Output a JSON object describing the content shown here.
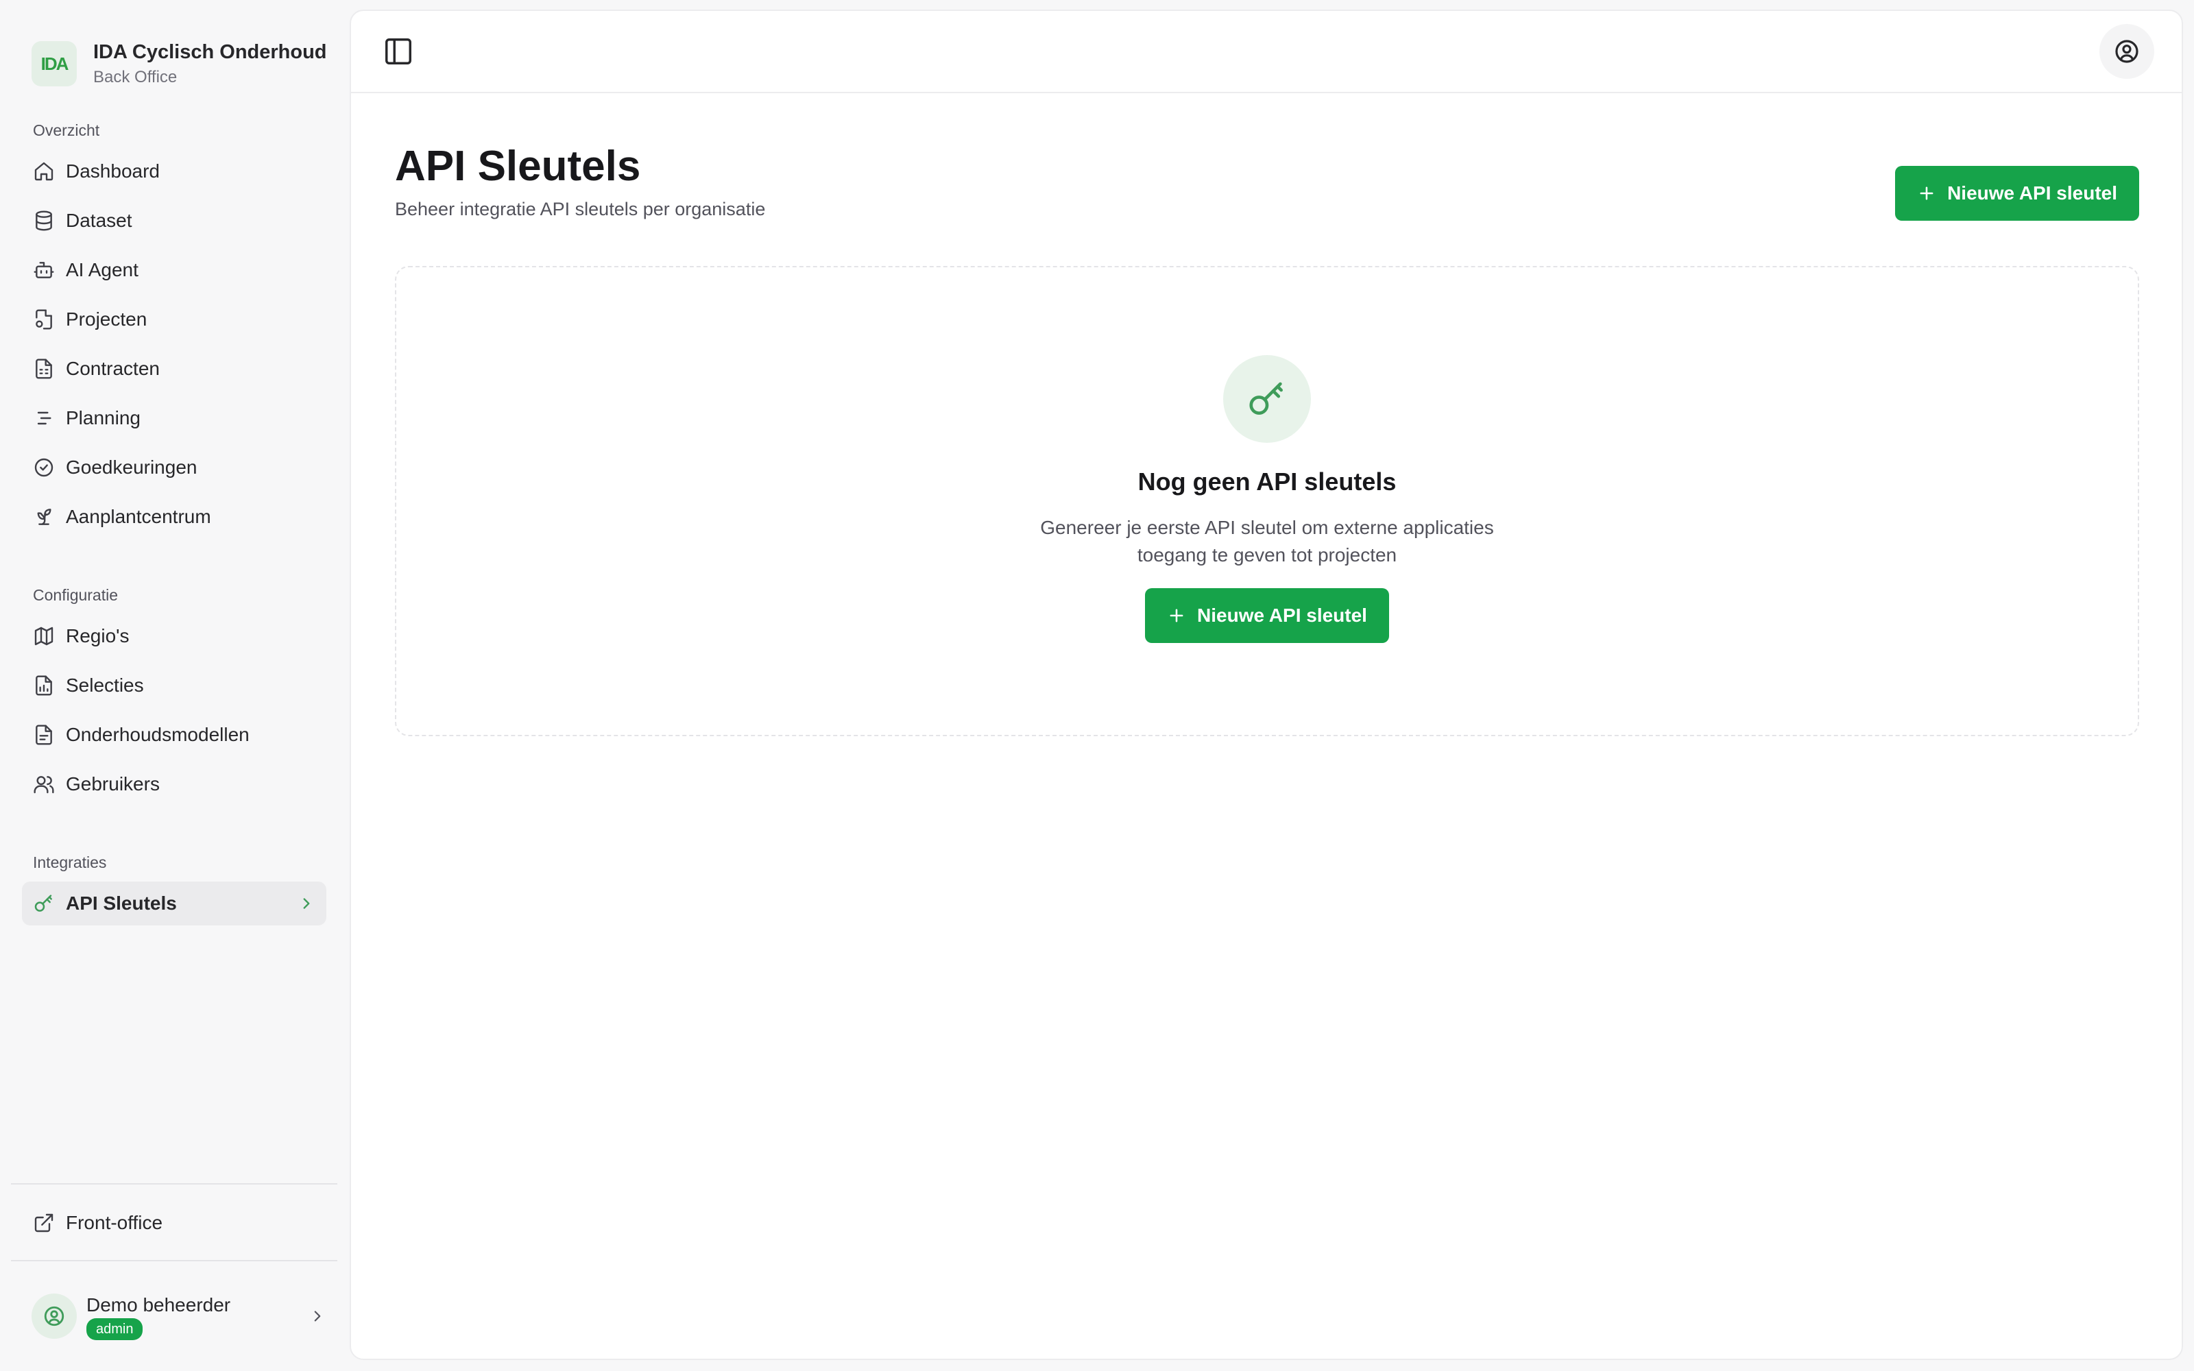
{
  "brand": {
    "logo_text": "IDA",
    "title": "IDA Cyclisch Onderhoud",
    "subtitle": "Back Office"
  },
  "sidebar": {
    "groups": [
      {
        "label": "Overzicht",
        "items": [
          {
            "label": "Dashboard",
            "icon": "home-icon"
          },
          {
            "label": "Dataset",
            "icon": "database-icon"
          },
          {
            "label": "AI Agent",
            "icon": "bot-icon"
          },
          {
            "label": "Projecten",
            "icon": "file-cog-icon"
          },
          {
            "label": "Contracten",
            "icon": "file-spreadsheet-icon"
          },
          {
            "label": "Planning",
            "icon": "list-indent-icon"
          },
          {
            "label": "Goedkeuringen",
            "icon": "circle-check-icon"
          },
          {
            "label": "Aanplantcentrum",
            "icon": "sprout-icon"
          }
        ]
      },
      {
        "label": "Configuratie",
        "items": [
          {
            "label": "Regio's",
            "icon": "map-icon"
          },
          {
            "label": "Selecties",
            "icon": "file-chart-icon"
          },
          {
            "label": "Onderhoudsmodellen",
            "icon": "file-cog-icon"
          },
          {
            "label": "Gebruikers",
            "icon": "users-icon"
          }
        ]
      },
      {
        "label": "Integraties",
        "items": [
          {
            "label": "API Sleutels",
            "icon": "key-icon",
            "active": true
          }
        ]
      }
    ],
    "front_office": "Front-office",
    "user": {
      "name": "Demo beheerder",
      "role": "admin"
    }
  },
  "page": {
    "title": "API Sleutels",
    "subtitle": "Beheer integratie API sleutels per organisatie",
    "new_button": "Nieuwe API sleutel"
  },
  "empty_state": {
    "title": "Nog geen API sleutels",
    "description": "Genereer je eerste API sleutel om externe applicaties toegang te geven tot projecten",
    "button": "Nieuwe API sleutel"
  },
  "colors": {
    "accent": "#16a34a",
    "icon_green": "#3f9c5a",
    "sidebar_bg": "#f7f7f8"
  }
}
